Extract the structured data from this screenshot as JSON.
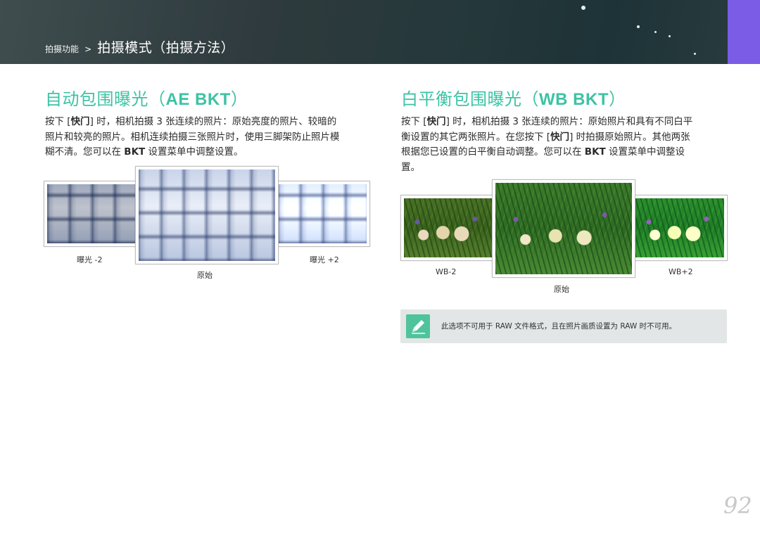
{
  "header": {
    "breadcrumb_parent": "拍摄功能",
    "breadcrumb_separator": ">",
    "breadcrumb_current": "拍摄模式（拍摄方法）"
  },
  "left_section": {
    "title_cn": "自动包围曝光（",
    "title_en": "AE BKT",
    "title_close": "）",
    "line1_a": "按下 [",
    "line1_key": "快门",
    "line1_b": "] 时，相机拍摄 3 张连续的照片：原始亮度的照片、较暗的",
    "line2": "照片和较亮的照片。相机连续拍摄三张照片时，使用三脚架防止照片模",
    "line3_a": "糊不清。您可以在 ",
    "line3_key": "BKT",
    "line3_b": " 设置菜单中调整设置。",
    "captions": {
      "left": "曝光 -2",
      "center": "原始",
      "right": "曝光 +2"
    }
  },
  "right_section": {
    "title_cn": "白平衡包围曝光（",
    "title_en": "WB BKT",
    "title_close": "）",
    "line1_a": "按下 [",
    "line1_key": "快门",
    "line1_b": "] 时，相机拍摄 3 张连续的照片：原始照片和具有不同白平",
    "line2_a": "衡设置的其它两张照片。在您按下 [",
    "line2_key": "快门",
    "line2_b": "] 时拍摄原始照片。其他两张",
    "line3_a": "根据您已设置的白平衡自动调整。您可以在 ",
    "line3_key": "BKT",
    "line3_b": " 设置菜单中调整设",
    "line4": "置。",
    "captions": {
      "left": "WB-2",
      "center": "原始",
      "right": "WB+2"
    },
    "note": "此选项不可用于 RAW 文件格式，且在照片画质设置为 RAW 时不可用。"
  },
  "page_number": "92",
  "colors": {
    "accent_heading": "#3cc3a4",
    "banner_tab": "#7a5ce6",
    "note_icon": "#4fc49c"
  }
}
